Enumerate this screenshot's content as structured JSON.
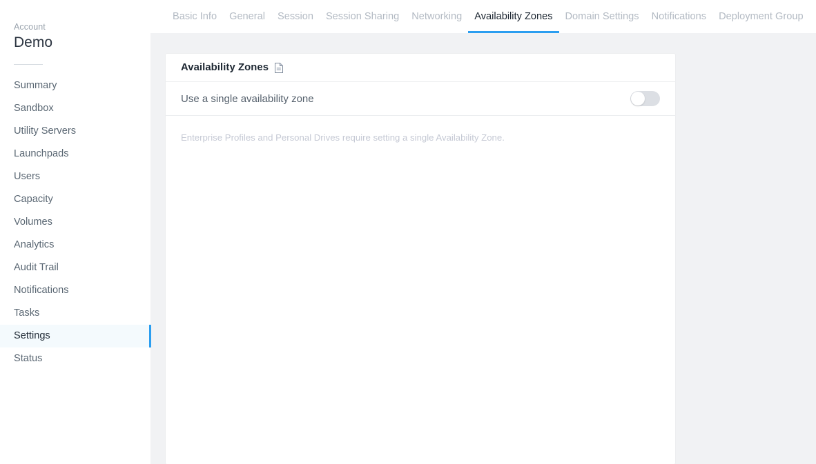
{
  "sidebar": {
    "account_label": "Account",
    "account_name": "Demo",
    "items": [
      {
        "label": "Summary",
        "active": false
      },
      {
        "label": "Sandbox",
        "active": false
      },
      {
        "label": "Utility Servers",
        "active": false
      },
      {
        "label": "Launchpads",
        "active": false
      },
      {
        "label": "Users",
        "active": false
      },
      {
        "label": "Capacity",
        "active": false
      },
      {
        "label": "Volumes",
        "active": false
      },
      {
        "label": "Analytics",
        "active": false
      },
      {
        "label": "Audit Trail",
        "active": false
      },
      {
        "label": "Notifications",
        "active": false
      },
      {
        "label": "Tasks",
        "active": false
      },
      {
        "label": "Settings",
        "active": true
      },
      {
        "label": "Status",
        "active": false
      }
    ]
  },
  "tabs": [
    {
      "label": "Basic Info",
      "active": false
    },
    {
      "label": "General",
      "active": false
    },
    {
      "label": "Session",
      "active": false
    },
    {
      "label": "Session Sharing",
      "active": false
    },
    {
      "label": "Networking",
      "active": false
    },
    {
      "label": "Availability Zones",
      "active": true
    },
    {
      "label": "Domain Settings",
      "active": false
    },
    {
      "label": "Notifications",
      "active": false
    },
    {
      "label": "Deployment Group",
      "active": false
    }
  ],
  "card": {
    "title": "Availability Zones",
    "doc_icon": "document-icon",
    "toggle": {
      "label": "Use a single availability zone",
      "state": "off"
    },
    "helper_text": "Enterprise Profiles and Personal Drives require setting a single Availability Zone."
  },
  "colors": {
    "accent": "#2b9ef0",
    "page_background": "#f1f2f4",
    "card_background": "#ffffff",
    "active_nav_background": "#f4fafd",
    "muted_text": "#b3bac3",
    "helper_text": "#c5c9d4",
    "switch_off_track": "#dcdfe4"
  }
}
